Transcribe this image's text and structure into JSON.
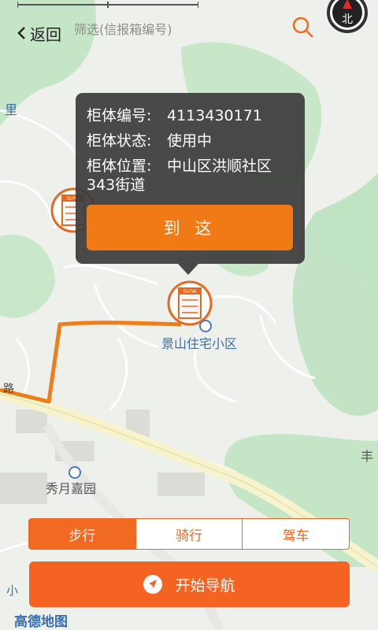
{
  "header": {
    "back_label": "返回",
    "filter_placeholder": "筛选(信报箱编号)",
    "compass_label": "北"
  },
  "popup": {
    "rows": [
      {
        "key": "柜体编号:",
        "value": "4113430171"
      },
      {
        "key": "柜体状态:",
        "value": "使用中"
      },
      {
        "key": "柜体位置:",
        "value": "中山区洪顺社区"
      },
      {
        "key": "",
        "value": "343街道"
      }
    ],
    "goto_label": "到 这"
  },
  "map": {
    "labels": {
      "community": "景山住宅小区",
      "garden": "秀月嘉园",
      "left_edge": "里",
      "right_edge": "丰",
      "road": "路",
      "bottom_left": "小"
    },
    "marker_label": "SUPAI",
    "route_color": "#ee7d1a",
    "marker_color": "#e9681e"
  },
  "modes": {
    "items": [
      {
        "label": "步行",
        "active": true
      },
      {
        "label": "骑行",
        "active": false
      },
      {
        "label": "驾车",
        "active": false
      }
    ]
  },
  "navigate": {
    "label": "开始导航"
  },
  "footer": {
    "logo": "高德地图"
  },
  "colors": {
    "accent": "#f46322",
    "popup_bg": "#3c3c3c"
  }
}
